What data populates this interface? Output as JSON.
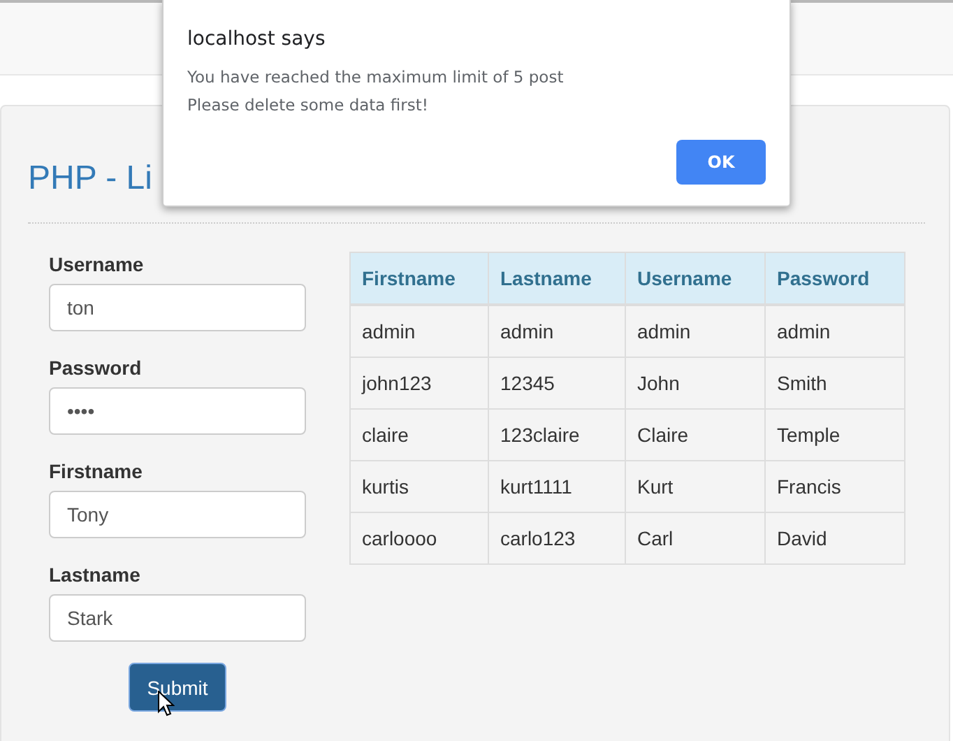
{
  "page": {
    "title": "PHP - Li"
  },
  "form": {
    "fields": [
      {
        "label": "Username",
        "value": "ton"
      },
      {
        "label": "Password",
        "value": "••••"
      },
      {
        "label": "Firstname",
        "value": "Tony"
      },
      {
        "label": "Lastname",
        "value": "Stark"
      }
    ],
    "submit": "Submit"
  },
  "table": {
    "columns": [
      "Firstname",
      "Lastname",
      "Username",
      "Password"
    ],
    "rows": [
      [
        "admin",
        "admin",
        "admin",
        "admin"
      ],
      [
        "john123",
        "12345",
        "John",
        "Smith"
      ],
      [
        "claire",
        "123claire",
        "Claire",
        "Temple"
      ],
      [
        "kurtis",
        "kurt1111",
        "Kurt",
        "Francis"
      ],
      [
        "carloooo",
        "carlo123",
        "Carl",
        "David"
      ]
    ]
  },
  "dialog": {
    "title": "localhost says",
    "message_lines": [
      "You have reached the maximum limit of 5 post",
      "Please delete some data first!"
    ],
    "button": "OK"
  }
}
